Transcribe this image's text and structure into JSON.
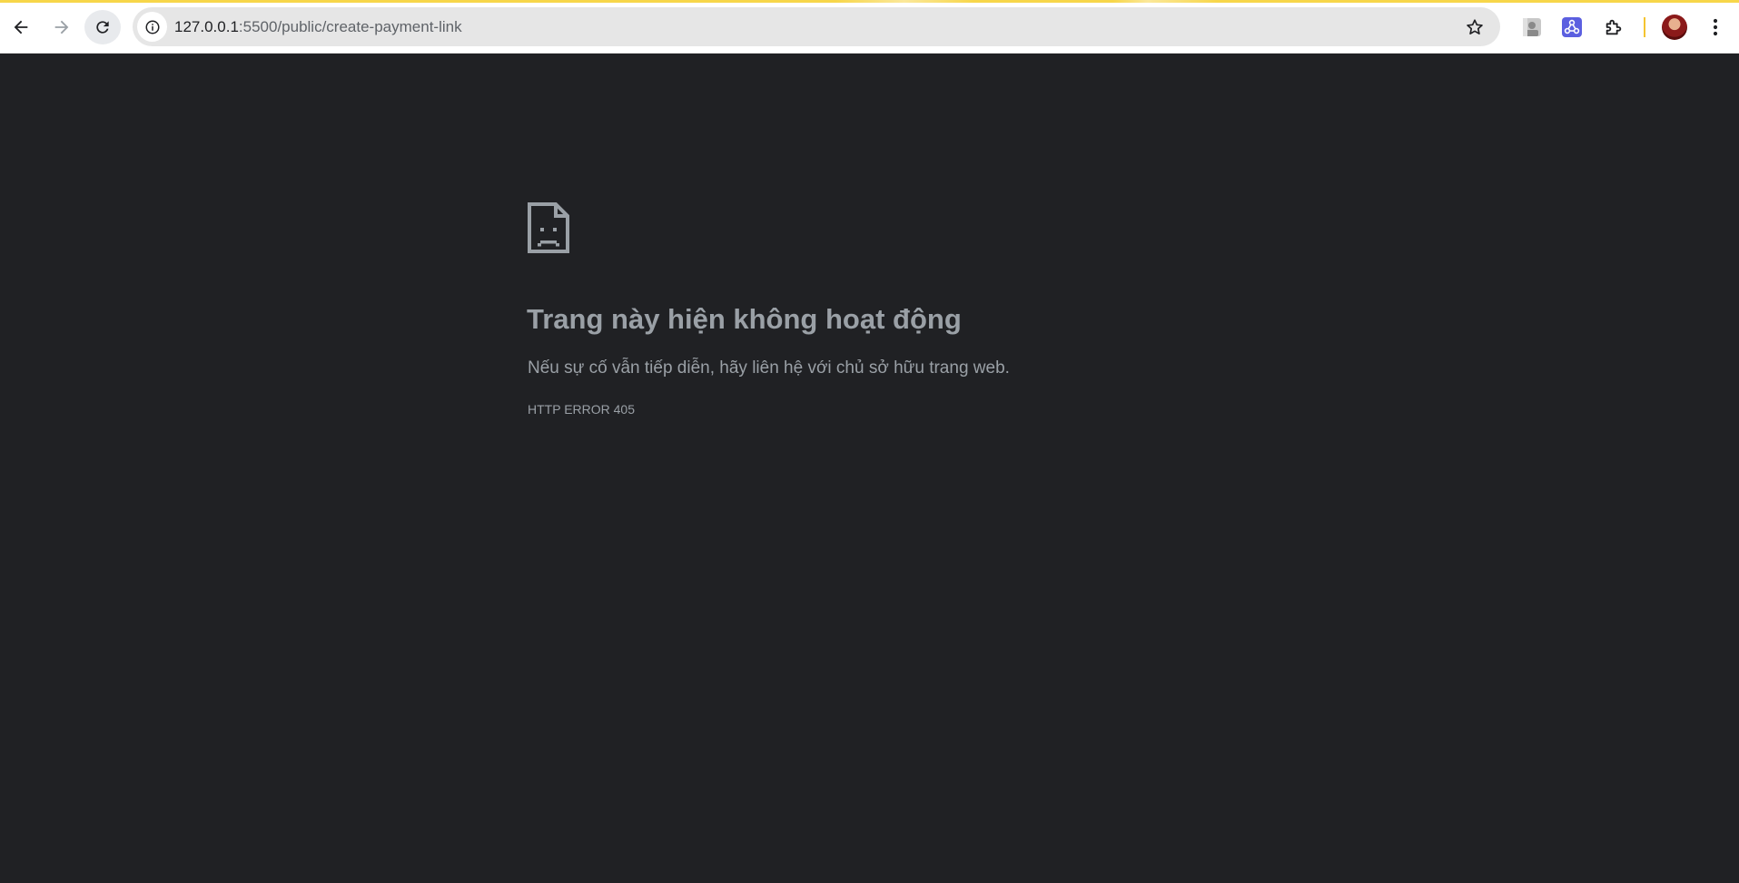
{
  "browser": {
    "address_bar": {
      "url_host": "127.0.0.1",
      "url_rest": ":5500/public/create-payment-link"
    },
    "icons": {
      "back": "arrow-left-icon",
      "forward": "arrow-right-icon",
      "reload": "reload-icon",
      "site_info": "info-icon",
      "bookmark": "star-icon",
      "extension_1": "extension-avatar-icon",
      "extension_2": "extension-network-icon",
      "extensions_menu": "puzzle-icon",
      "profile": "profile-avatar",
      "menu": "vertical-dots-icon"
    },
    "colors": {
      "loading_bar": "#f7d64a",
      "extension_2_bg": "#5b5fe0",
      "divider": "#f4c430"
    }
  },
  "error_page": {
    "icon": "sad-document-icon",
    "title": "Trang này hiện không hoạt động",
    "description": "Nếu sự cố vẫn tiếp diễn, hãy liên hệ với chủ sở hữu trang web.",
    "error_code": "HTTP ERROR 405",
    "colors": {
      "background": "#202124",
      "text": "#9aa0a6"
    }
  }
}
